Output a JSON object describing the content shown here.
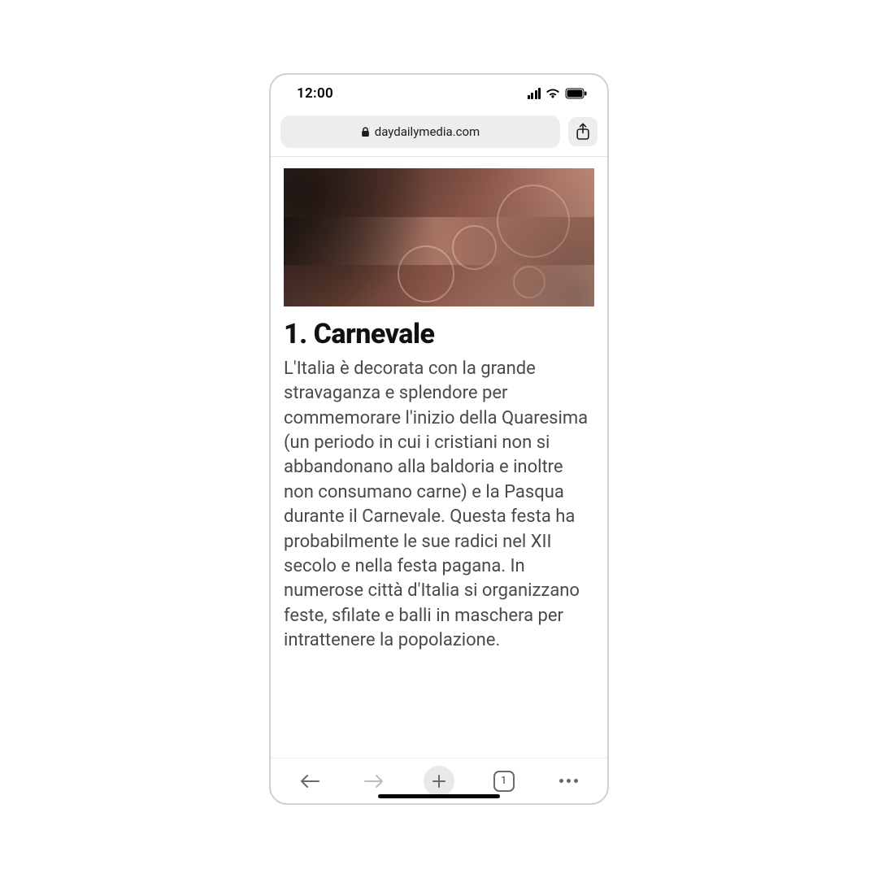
{
  "status": {
    "time": "12:00"
  },
  "browser": {
    "url_display": "daydailymedia.com",
    "tabs_count": "1"
  },
  "article": {
    "heading": "1. Carnevale",
    "body": "L'Italia è decorata con la grande stravaganza e splendore per commemorare l'inizio della Quaresima (un periodo in cui i cristiani non si abbandonano alla baldoria e inoltre non consumano carne) e la Pasqua durante il Carnevale. Questa festa ha probabilmente le sue radici nel XII secolo e nella festa pagana. In numerose città d'Italia si organizzano feste, sfilate e balli in maschera per intrattenere la popolazione."
  }
}
